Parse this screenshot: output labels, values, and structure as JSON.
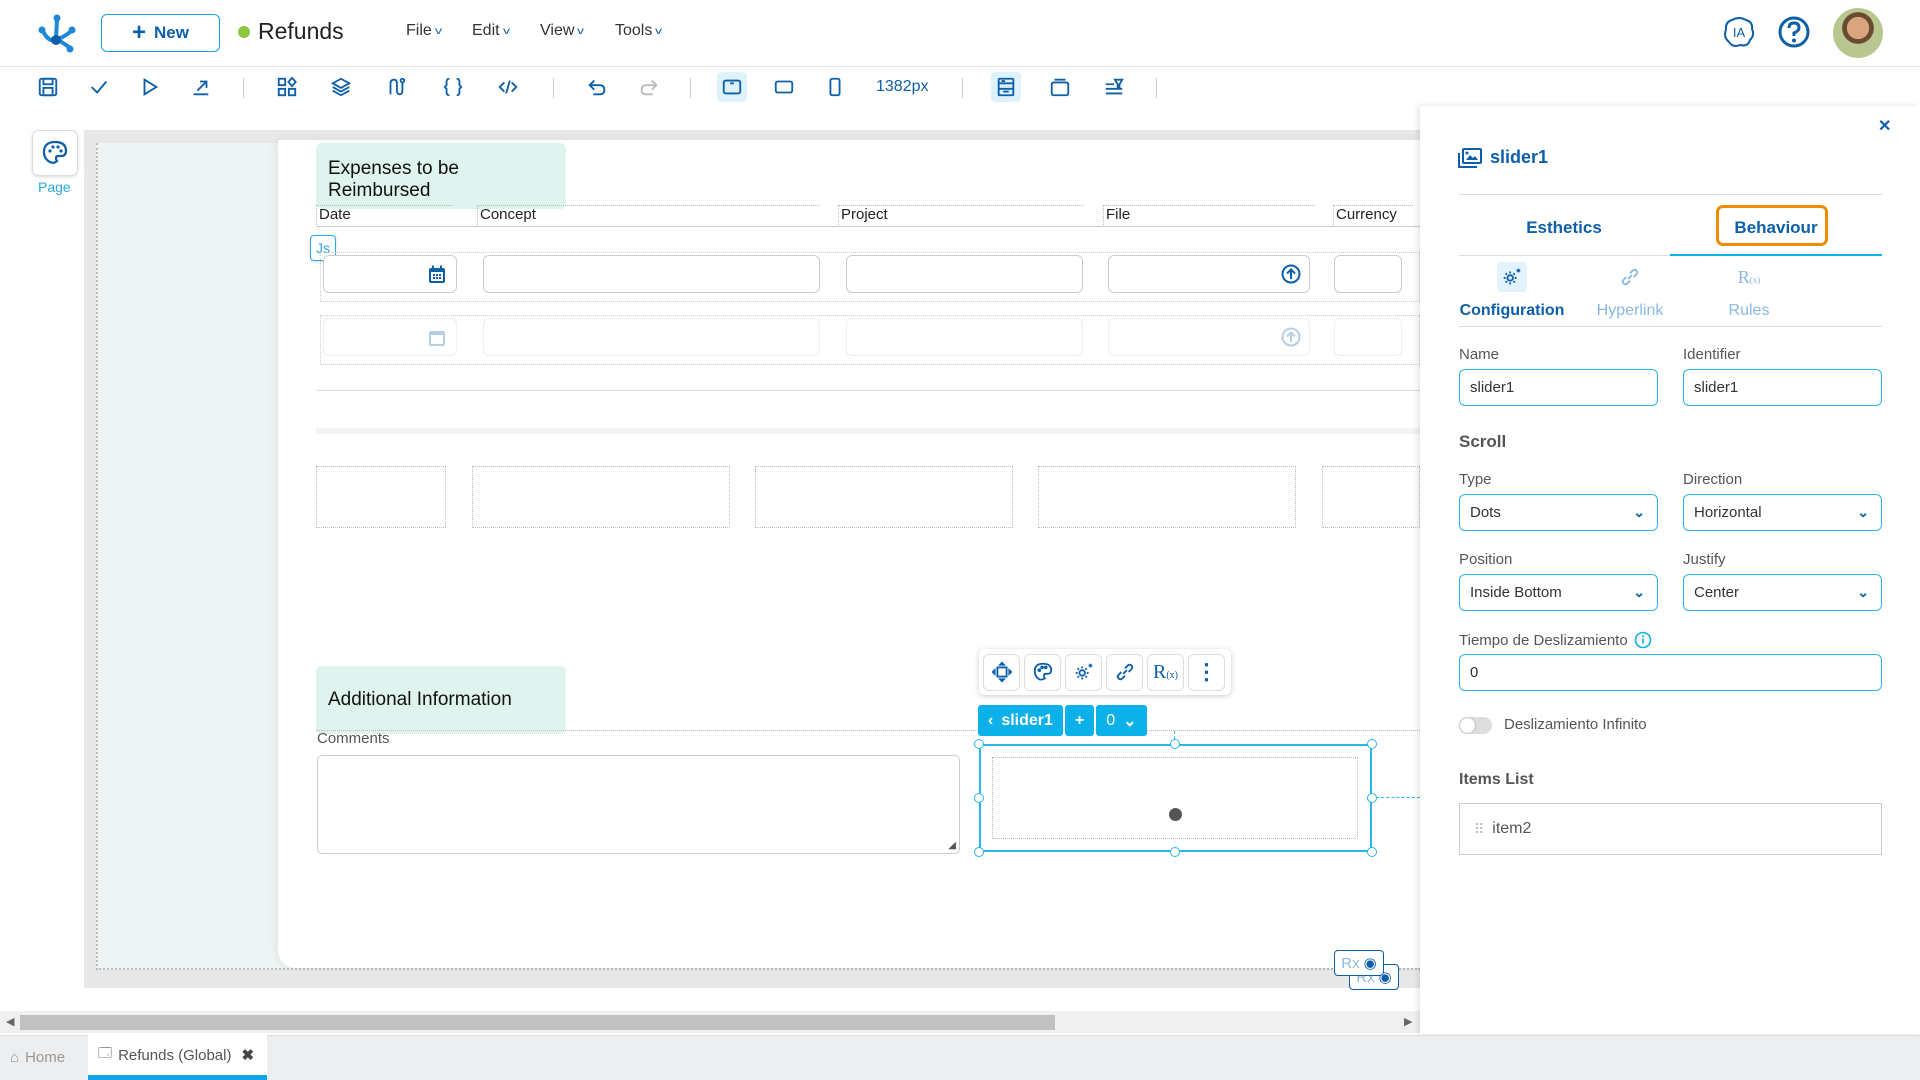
{
  "header": {
    "new_label": "New",
    "app_title": "Refunds",
    "status_color": "#8cc63f",
    "menus": [
      {
        "label": "File"
      },
      {
        "label": "Edit"
      },
      {
        "label": "View"
      },
      {
        "label": "Tools"
      }
    ],
    "ia_label": "IA"
  },
  "toolbar": {
    "icons": [
      "save-icon",
      "check-icon",
      "play-icon",
      "export-icon",
      "components-icon",
      "layers-icon",
      "flow-icon",
      "braces-icon",
      "code-icon",
      "undo-icon",
      "redo-icon",
      "desktop-icon",
      "tablet-icon",
      "mobile-icon",
      "layout-icon",
      "window-icon",
      "filter-icon"
    ],
    "width_readout": "1382px"
  },
  "left_rail": {
    "page_label": "Page"
  },
  "canvas": {
    "expenses_title": "Expenses to be Reimbursed",
    "columns": [
      "Date",
      "Concept",
      "Project",
      "File",
      "Currency"
    ],
    "js_badge": "Js",
    "additional_title": "Additional Information",
    "comments_label": "Comments",
    "selection": {
      "name": "slider1",
      "add": "+",
      "index": "0"
    },
    "rx_badge": "Rx"
  },
  "panel": {
    "title": "slider1",
    "tabs": [
      "Esthetics",
      "Behaviour"
    ],
    "active_tab": "Behaviour",
    "subtabs": [
      "Configuration",
      "Hyperlink",
      "Rules"
    ],
    "active_subtab": "Configuration",
    "name_label": "Name",
    "name_value": "slider1",
    "identifier_label": "Identifier",
    "identifier_value": "slider1",
    "scroll_heading": "Scroll",
    "type_label": "Type",
    "type_value": "Dots",
    "direction_label": "Direction",
    "direction_value": "Horizontal",
    "position_label": "Position",
    "position_value": "Inside Bottom",
    "justify_label": "Justify",
    "justify_value": "Center",
    "slide_time_label": "Tiempo de Deslizamiento",
    "slide_time_value": "0",
    "infinite_label": "Deslizamiento Infinito",
    "infinite_on": false,
    "items_heading": "Items List",
    "items": [
      "item2"
    ]
  },
  "bottom_tabs": {
    "home": "Home",
    "active": "Refunds (Global)"
  }
}
